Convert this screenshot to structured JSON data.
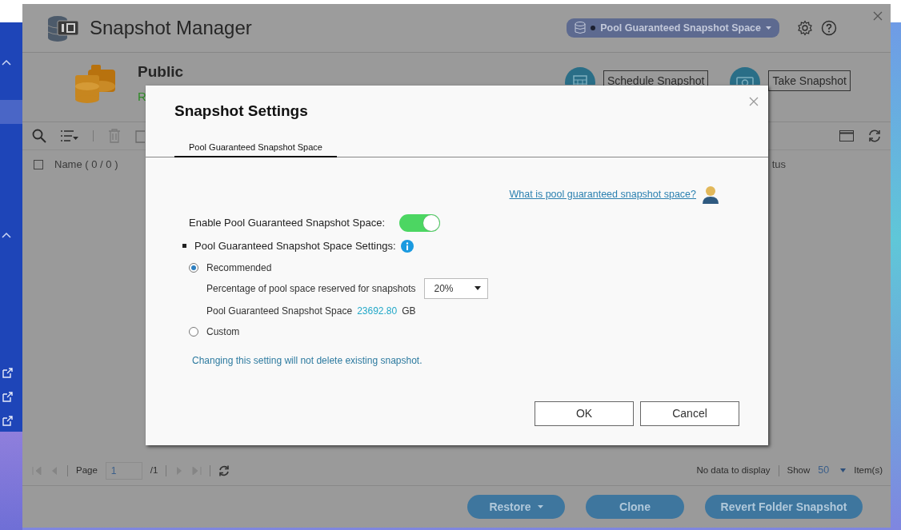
{
  "app": {
    "title": "Snapshot Manager",
    "pool_selector": "Pool Guaranteed Snapshot Space"
  },
  "volume": {
    "name": "Public",
    "status": "R"
  },
  "actions": [
    {
      "label": "Schedule Snapshot"
    },
    {
      "label": "Take Snapshot"
    }
  ],
  "table": {
    "columns": [
      "Name ( 0 / 0 )",
      "tus"
    ],
    "select_all_checked": false
  },
  "pager": {
    "page_label": "Page",
    "page": "1",
    "total": "/1",
    "summary": "No data to display",
    "show_label": "Show",
    "page_size": "50",
    "items_label": "Item(s)"
  },
  "bottom_buttons": [
    {
      "label": "Restore",
      "dropdown": true
    },
    {
      "label": "Clone",
      "dropdown": false
    },
    {
      "label": "Revert Folder Snapshot",
      "dropdown": false
    }
  ],
  "dialog": {
    "title": "Snapshot Settings",
    "tabs": [
      {
        "label": "Pool Guaranteed Snapshot Space",
        "selected": true
      }
    ],
    "help_link": "What is pool guaranteed snapshot space?",
    "enable_label": "Enable Pool Guaranteed Snapshot Space:",
    "enable_on": true,
    "section_label": "Pool Guaranteed Snapshot Space Settings:",
    "options": [
      {
        "label": "Recommended",
        "selected": true
      },
      {
        "label": "Custom",
        "selected": false
      }
    ],
    "percentage_label": "Percentage of pool space reserved for snapshots",
    "percentage": "20%",
    "space_label": "Pool Guaranteed Snapshot Space",
    "space_value": "23692.80",
    "space_unit": "GB",
    "note": "Changing this setting will not delete existing snapshot.",
    "buttons": [
      "OK",
      "Cancel"
    ]
  }
}
